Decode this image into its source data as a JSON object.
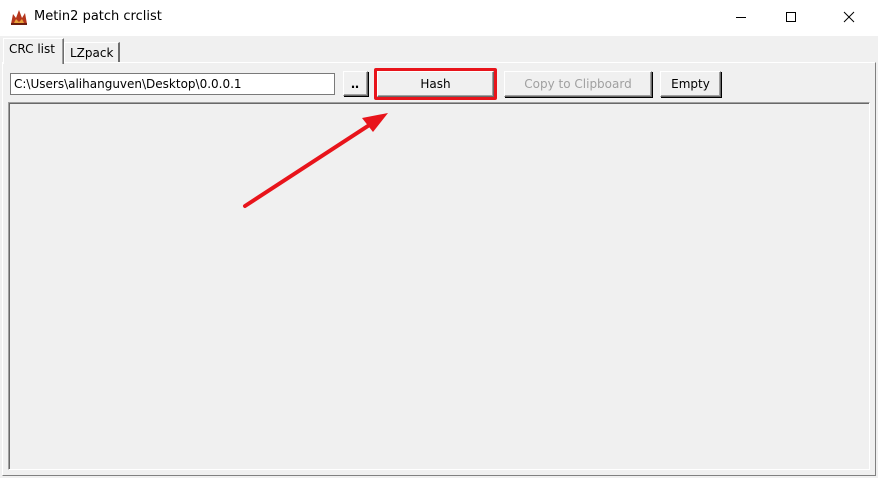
{
  "window": {
    "title": "Metin2 patch crclist",
    "app_icon": "metin2-app-icon",
    "controls": [
      "minimize-icon",
      "maximize-icon",
      "close-icon"
    ]
  },
  "tabs": [
    {
      "label": "CRC list",
      "active": true
    },
    {
      "label": "LZpack",
      "active": false
    }
  ],
  "toolbar": {
    "path_value": "C:\\Users\\alihanguven\\Desktop\\0.0.0.1",
    "browse_label": "‥",
    "hash_label": "Hash",
    "copy_label": "Copy to Clipboard",
    "copy_enabled": false,
    "empty_label": "Empty"
  },
  "annotation": {
    "color": "#e8141b",
    "highlight_target": "hash-button",
    "arrow": "red-arrow-pointing-to-hash"
  }
}
